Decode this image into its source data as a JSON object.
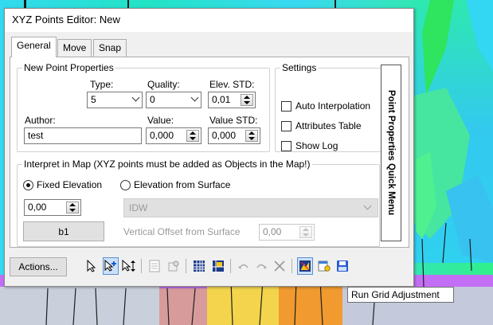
{
  "window": {
    "title": "XYZ Points Editor: New"
  },
  "tabs": [
    {
      "label": "General",
      "active": true
    },
    {
      "label": "Move",
      "active": false
    },
    {
      "label": "Snap",
      "active": false
    }
  ],
  "new_point": {
    "legend": "New Point Properties",
    "type_label": "Type:",
    "type_value": "5",
    "quality_label": "Quality:",
    "quality_value": "0",
    "elev_std_label": "Elev. STD:",
    "elev_std_value": "0,01",
    "author_label": "Author:",
    "author_value": "test",
    "value_label": "Value:",
    "value_value": "0,000",
    "value_std_label": "Value STD:",
    "value_std_value": "0,000"
  },
  "settings": {
    "legend": "Settings",
    "auto_interpolation": {
      "label": "Auto Interpolation",
      "checked": false
    },
    "attributes_table": {
      "label": "Attributes Table",
      "checked": false
    },
    "show_log": {
      "label": "Show Log",
      "checked": false
    }
  },
  "interpret": {
    "legend": "Interpret in Map (XYZ points must be added as Objects in the Map!)",
    "fixed_elevation_label": "Fixed Elevation",
    "fixed_elevation_checked": true,
    "elevation_surface_label": "Elevation from Surface",
    "fixed_value": "0,00",
    "method_value": "IDW",
    "b1_label": "b1",
    "offset_label": "Vertical Offset from Surface",
    "offset_value": "0,00"
  },
  "side_menu": {
    "label": "Point Properties Quick Menu"
  },
  "toolbar": {
    "actions_label": "Actions...",
    "tooltip": "Run Grid Adjustment",
    "icons": [
      "select-arrow-icon",
      "add-point-icon",
      "move-point-icon",
      "table-icon",
      "delete-point-icon",
      "grid-icon",
      "grid-color-icon",
      "undo-icon",
      "redo-icon",
      "clear-icon",
      "run-grid-adjustment-icon",
      "properties-icon",
      "save-icon"
    ]
  },
  "colors": {
    "dialog_bg": "#f0f0f0",
    "selection_blue": "#cce0f7",
    "map_green": "#2fd3a0",
    "map_purple": "#c070ff"
  }
}
